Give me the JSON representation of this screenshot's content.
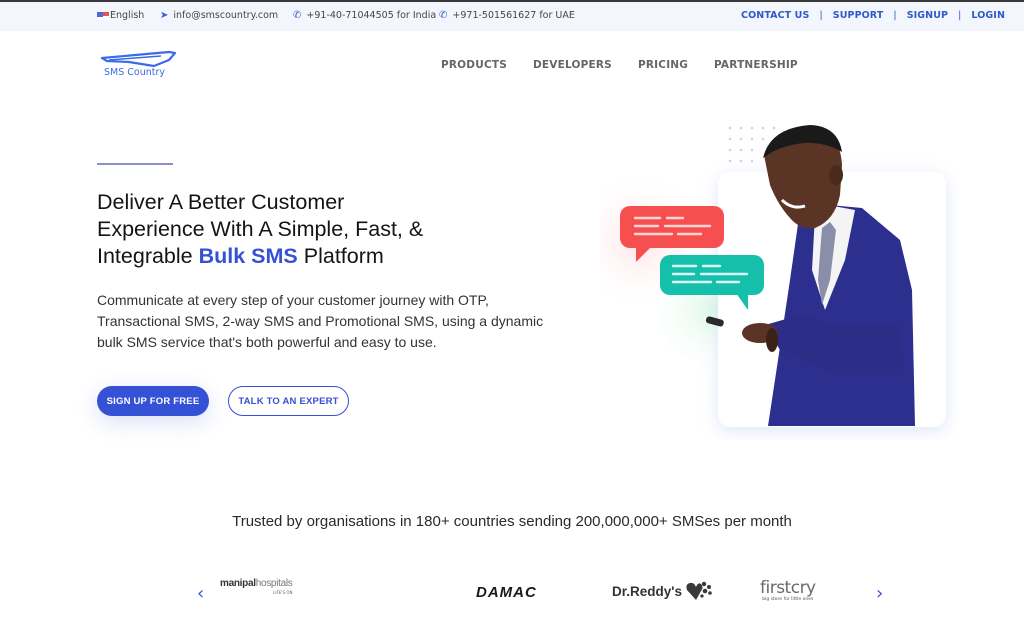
{
  "topbar": {
    "language": "English",
    "email": "info@smscountry.com",
    "phone_india": "+91-40-71044505 for India",
    "phone_uae": "+971-501561627 for UAE",
    "links": [
      "CONTACT US",
      "SUPPORT",
      "SIGNUP",
      "LOGIN"
    ],
    "separator": "|"
  },
  "logo": {
    "text": "SMS Country"
  },
  "nav": {
    "items": [
      "PRODUCTS",
      "DEVELOPERS",
      "PRICING",
      "PARTNERSHIP"
    ]
  },
  "hero": {
    "headline_line1": "Deliver A Better Customer",
    "headline_line2": "Experience With A Simple, Fast, &",
    "headline_line3_pre": "Integrable ",
    "headline_highlight": "Bulk SMS",
    "headline_line3_post": " Platform",
    "description": "Communicate at every step of your customer journey with OTP, Transactional SMS, 2-way SMS and Promotional SMS, using a dynamic bulk SMS service that's both powerful and easy to use.",
    "primary_button": "SIGN UP FOR FREE",
    "secondary_button": "TALK TO AN EXPERT",
    "colors": {
      "accent": "#3551d6",
      "bubble_red": "#f5504f",
      "bubble_teal": "#16bfa9",
      "suit": "#2d2f8f"
    }
  },
  "trust": {
    "tagline": "Trusted by organisations in 180+ countries sending 200,000,000+ SMSes per month",
    "clients": [
      {
        "name": "manipal",
        "name2": "hospitals",
        "sub": "LIFE'S ON"
      },
      {
        "name": "DAMAC"
      },
      {
        "name": "Dr.Reddy's"
      },
      {
        "name": "firstcry",
        "sub": "big store for little ones"
      }
    ],
    "prev_icon": "‹",
    "next_icon": "›"
  }
}
